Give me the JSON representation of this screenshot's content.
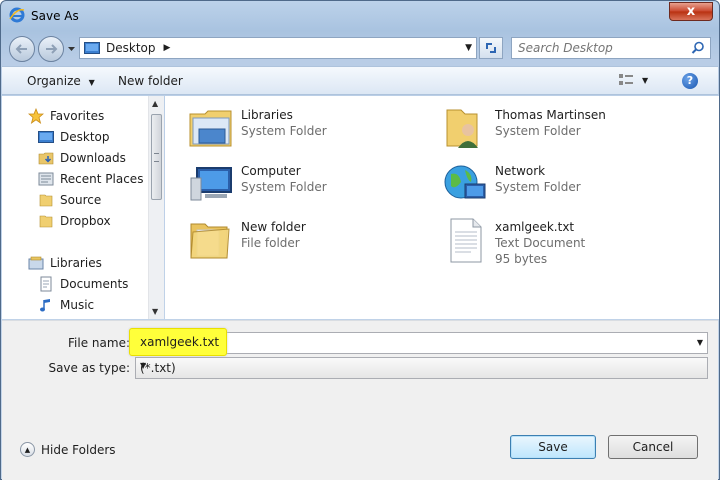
{
  "window": {
    "title": "Save As",
    "close_symbol": "x"
  },
  "address": {
    "location": "Desktop",
    "separator": "▶"
  },
  "search": {
    "placeholder": "Search Desktop"
  },
  "toolbar": {
    "organize_label": "Organize",
    "new_folder_label": "New folder",
    "help_symbol": "?"
  },
  "navigation": {
    "favorites_header": "Favorites",
    "favorites": [
      "Desktop",
      "Downloads",
      "Recent Places",
      "Source",
      "Dropbox"
    ],
    "libraries_header": "Libraries",
    "libraries": [
      "Documents",
      "Music"
    ]
  },
  "files": [
    {
      "name": "Libraries",
      "type": "System Folder",
      "icon": "libraries-icon"
    },
    {
      "name": "Thomas Martinsen",
      "type": "System Folder",
      "icon": "user-folder-icon"
    },
    {
      "name": "Computer",
      "type": "System Folder",
      "icon": "computer-icon"
    },
    {
      "name": "Network",
      "type": "System Folder",
      "icon": "network-icon"
    },
    {
      "name": "New folder",
      "type": "File folder",
      "icon": "folder-icon"
    },
    {
      "name": "xamlgeek.txt",
      "type": "Text Document",
      "size": "95 bytes",
      "icon": "text-file-icon"
    }
  ],
  "form": {
    "file_name_label": "File name:",
    "file_name_value": "xamlgeek.txt",
    "save_as_type_label": "Save as type:",
    "save_as_type_value": "(*.txt)"
  },
  "buttons": {
    "hide_folders": "Hide Folders",
    "save": "Save",
    "cancel": "Cancel"
  },
  "colors": {
    "highlight": "#ffff3a",
    "accent": "#3c7fb1"
  }
}
